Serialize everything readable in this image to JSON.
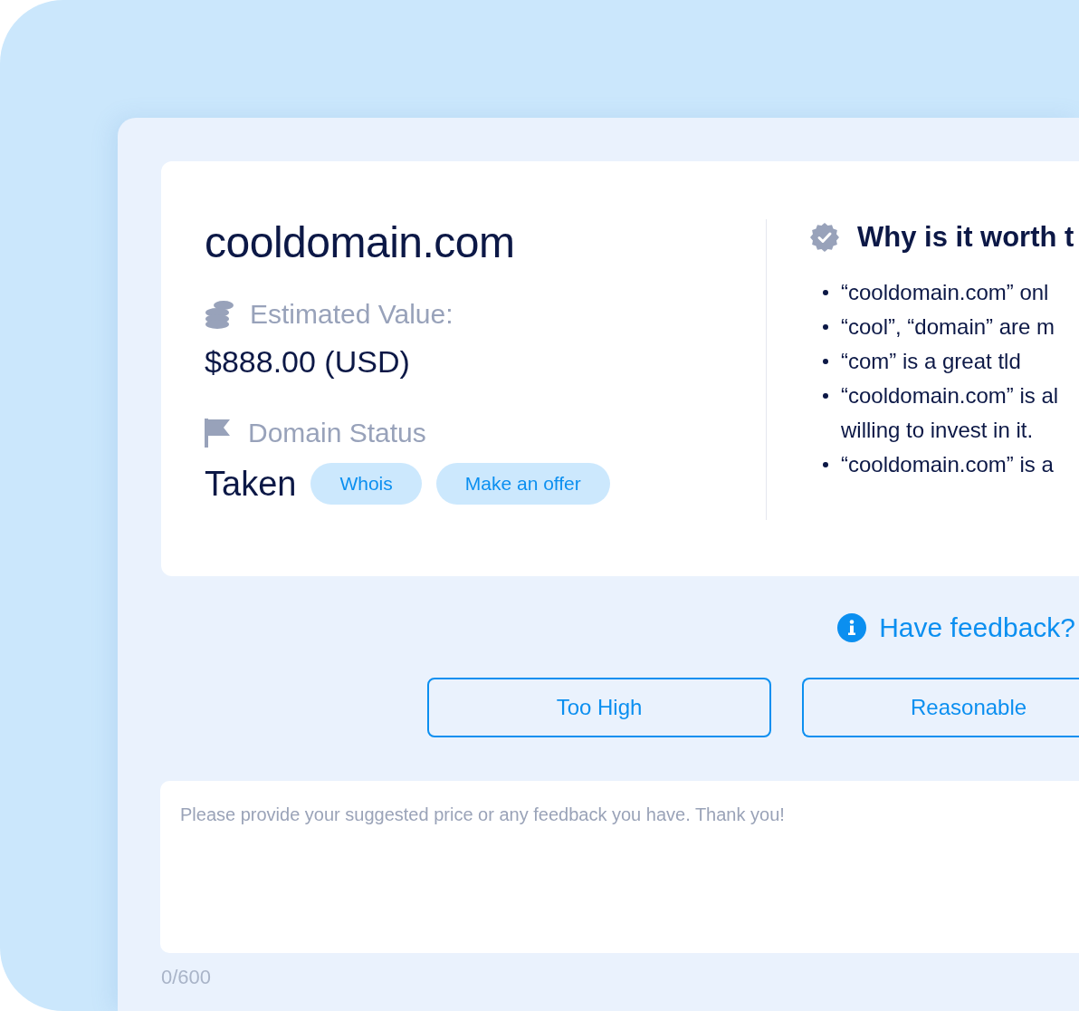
{
  "domain": {
    "name": "cooldomain.com",
    "estimated_value": {
      "label": "Estimated Value:",
      "value": "$888.00 (USD)"
    },
    "status": {
      "label": "Domain Status",
      "value": "Taken",
      "actions": [
        "Whois",
        "Make an offer"
      ]
    }
  },
  "worth": {
    "title": "Why is it worth t",
    "reasons": [
      {
        "lines": [
          "“cooldomain.com” onl"
        ]
      },
      {
        "lines": [
          "“cool”, “domain” are m"
        ]
      },
      {
        "lines": [
          "“com” is a great tld"
        ]
      },
      {
        "lines": [
          "“cooldomain.com” is al",
          "willing to invest in it."
        ]
      },
      {
        "lines": [
          "“cooldomain.com” is a"
        ]
      }
    ]
  },
  "feedback": {
    "title": "Have feedback?",
    "options": [
      "Too High",
      "Reasonable"
    ],
    "placeholder": "Please provide your suggested price or any feedback you have. Thank you!",
    "counter": "0/600"
  }
}
